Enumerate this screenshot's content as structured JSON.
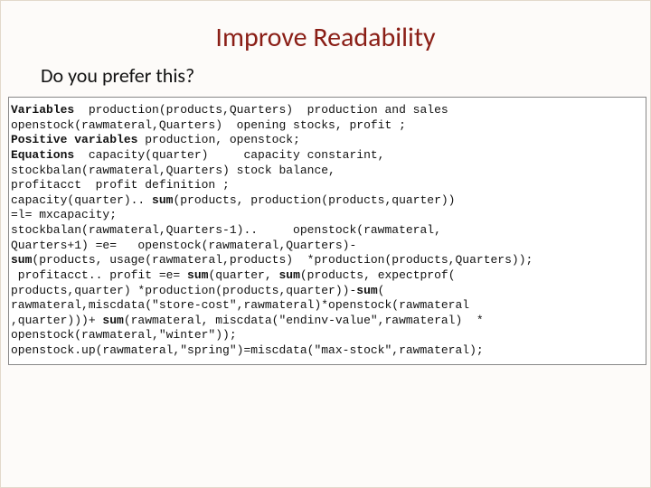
{
  "title": "Improve Readability",
  "subtitle": "Do you prefer this?",
  "code_keywords": [
    "Variables",
    "Positive variables",
    "Equations",
    "sum",
    "sum",
    "sum",
    "sum",
    "sum",
    "sum",
    "sum"
  ],
  "code": {
    "l01a": "Variables",
    "l01b": "  production(products,Quarters)  production and sales",
    "l02": "openstock(rawmateral,Quarters)  opening stocks, profit ;",
    "l03a": "Positive variables",
    "l03b": " production, openstock;",
    "l04a": "Equations",
    "l04b": "  capacity(quarter)     capacity constarint,",
    "l05": "stockbalan(rawmateral,Quarters) stock balance,",
    "l06": "profitacct  profit definition ;",
    "l07a": "capacity(quarter).. ",
    "l07b": "sum",
    "l07c": "(products, production(products,quarter))",
    "l08": "=l= mxcapacity;",
    "l09": "stockbalan(rawmateral,Quarters-1)..     openstock(rawmateral,",
    "l10": "Quarters+1) =e=   openstock(rawmateral,Quarters)-",
    "l11a": "sum",
    "l11b": "(products, usage(rawmateral,products)  *production(products,Quarters));",
    "l12a": " profitacct.. profit =e= ",
    "l12b": "sum",
    "l12c": "(quarter, ",
    "l12d": "sum",
    "l12e": "(products, expectprof(",
    "l13a": "products,quarter) *production(products,quarter))-",
    "l13b": "sum",
    "l13c": "(",
    "l14": "rawmateral,miscdata(\"store-cost\",rawmateral)*openstock(rawmateral",
    "l15a": ",quarter)))+ ",
    "l15b": "sum",
    "l15c": "(rawmateral, miscdata(\"endinv-value\",rawmateral)  *",
    "l16": "openstock(rawmateral,\"winter\"));",
    "l17": "openstock.up(rawmateral,\"spring\")=miscdata(\"max-stock\",rawmateral);"
  }
}
